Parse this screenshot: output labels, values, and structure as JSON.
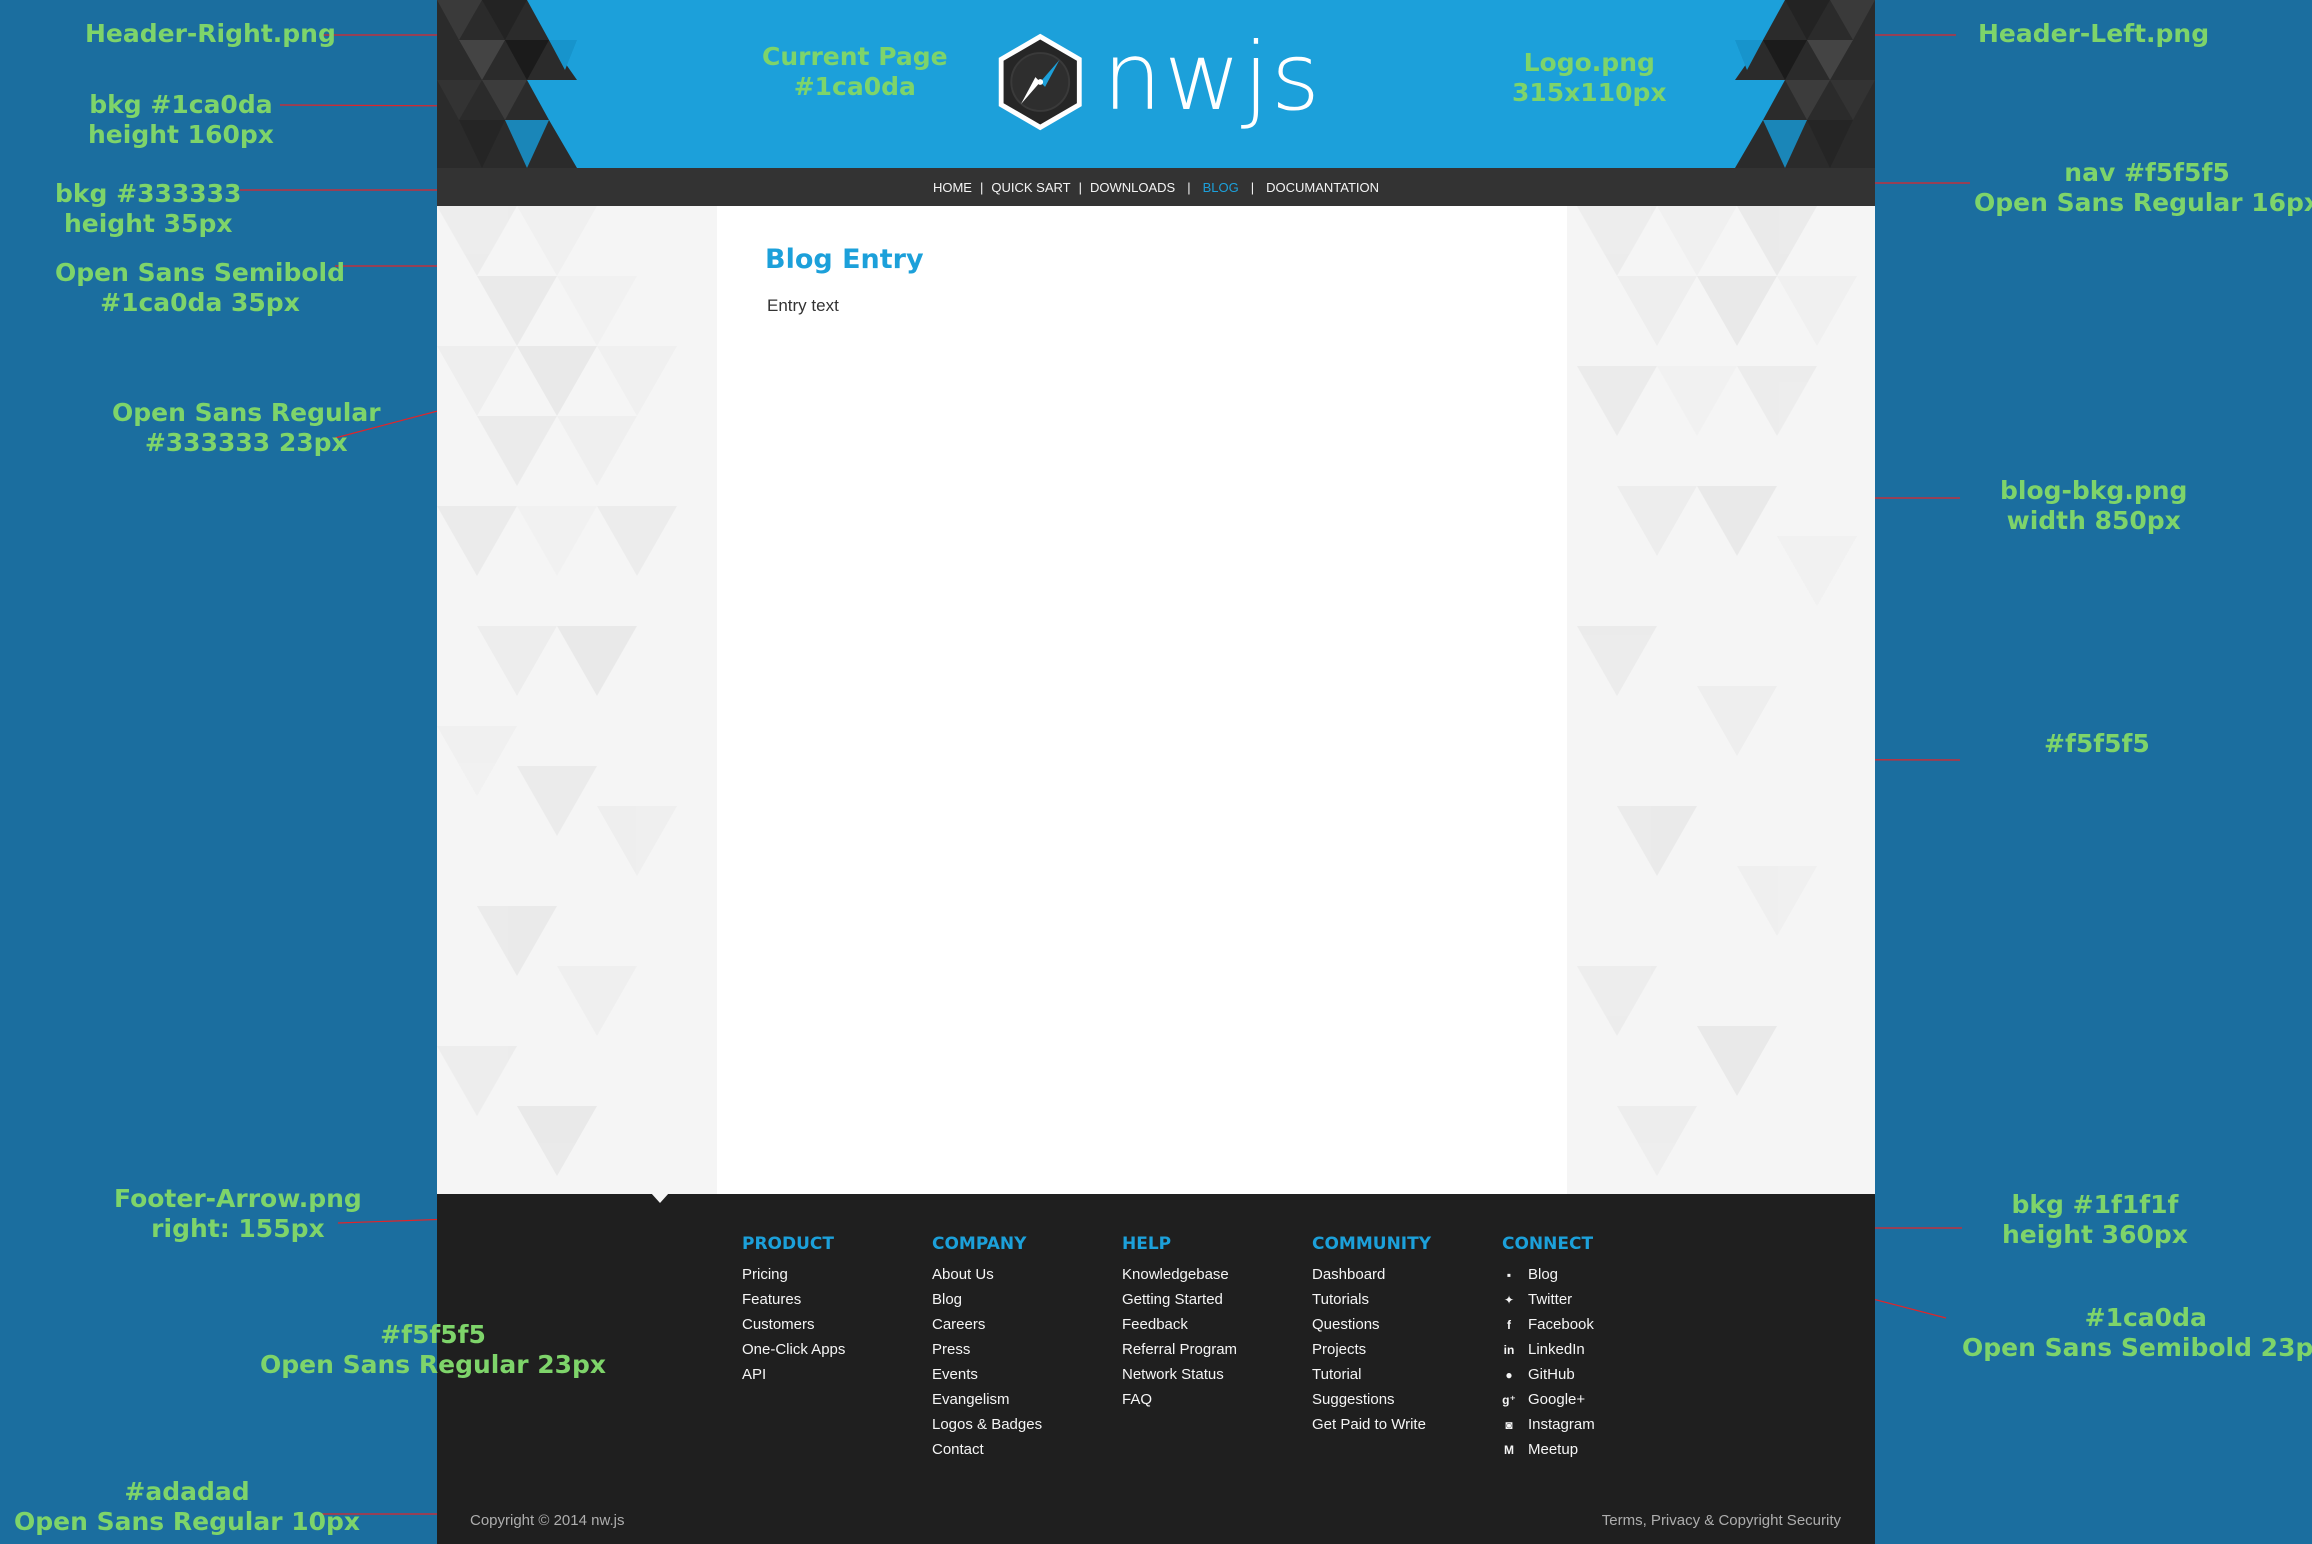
{
  "annotations": {
    "header_right": [
      "Header-Right.png"
    ],
    "header_bkg": [
      "bkg #1ca0da",
      "height  160px"
    ],
    "nav_bkg": [
      "bkg #333333",
      "height 35px"
    ],
    "title_font": [
      "Open Sans Semibold",
      "#1ca0da 35px"
    ],
    "entry_font": [
      "Open Sans Regular",
      "#333333 23px"
    ],
    "current_page": [
      "Current Page",
      "#1ca0da"
    ],
    "logo": [
      "Logo.png",
      "315x110px"
    ],
    "header_left": [
      "Header-Left.png"
    ],
    "nav_font": [
      "nav #f5f5f5",
      "Open Sans Regular 16px"
    ],
    "blog_bkg": [
      "blog-bkg.png",
      "width 850px"
    ],
    "content_color": [
      "#f5f5f5"
    ],
    "footer_arrow": [
      "Footer-Arrow.png",
      "right: 155px"
    ],
    "footer_links_font": [
      "#f5f5f5",
      "Open Sans Regular 23px"
    ],
    "copyright_font": [
      "#adadad",
      "Open Sans Regular 10px"
    ],
    "footer_bkg": [
      "bkg #1f1f1f",
      "height 360px"
    ],
    "footer_heading_font": [
      "#1ca0da",
      "Open Sans Semibold 23px"
    ]
  },
  "header": {
    "logo_text": "nwjs"
  },
  "nav": {
    "items": [
      "HOME",
      "QUICK SART",
      "DOWNLOADS",
      "BLOG",
      "DOCUMANTATION"
    ],
    "current_index": 3
  },
  "blog": {
    "title": "Blog Entry",
    "text": "Entry text"
  },
  "footer": {
    "columns": [
      {
        "heading": "PRODUCT",
        "links": [
          "Pricing",
          "Features",
          "Customers",
          "One-Click Apps",
          "API"
        ]
      },
      {
        "heading": "COMPANY",
        "links": [
          "About Us",
          "Blog",
          "Careers",
          "Press",
          "Events",
          "Evangelism",
          "Logos & Badges",
          "Contact"
        ]
      },
      {
        "heading": "HELP",
        "links": [
          "Knowledgebase",
          "Getting Started",
          "Feedback",
          "Referral Program",
          "Network Status",
          "FAQ"
        ]
      },
      {
        "heading": "COMMUNITY",
        "links": [
          "Dashboard",
          "Tutorials",
          "Questions",
          "Projects",
          "Tutorial",
          "Suggestions",
          "Get Paid to Write"
        ]
      },
      {
        "heading": "CONNECT",
        "links": [
          "Blog",
          "Twitter",
          "Facebook",
          "LinkedIn",
          "GitHub",
          "Google+",
          "Instagram",
          "Meetup"
        ],
        "icons": [
          "blog-icon",
          "twitter-icon",
          "facebook-icon",
          "linkedin-icon",
          "github-icon",
          "google-plus-icon",
          "instagram-icon",
          "meetup-icon"
        ]
      }
    ],
    "copyright": "Copyright © 2014 nw.js",
    "terms": "Terms, Privacy & Copyright Security"
  },
  "colors": {
    "annotation": "#7ed46a",
    "backdrop": "#1b6e9f",
    "header": "#1ca0da",
    "nav": "#333333",
    "nav_text": "#f5f5f5",
    "content_bg": "#f5f5f5",
    "footer": "#1f1f1f",
    "muted_text": "#adadad"
  }
}
